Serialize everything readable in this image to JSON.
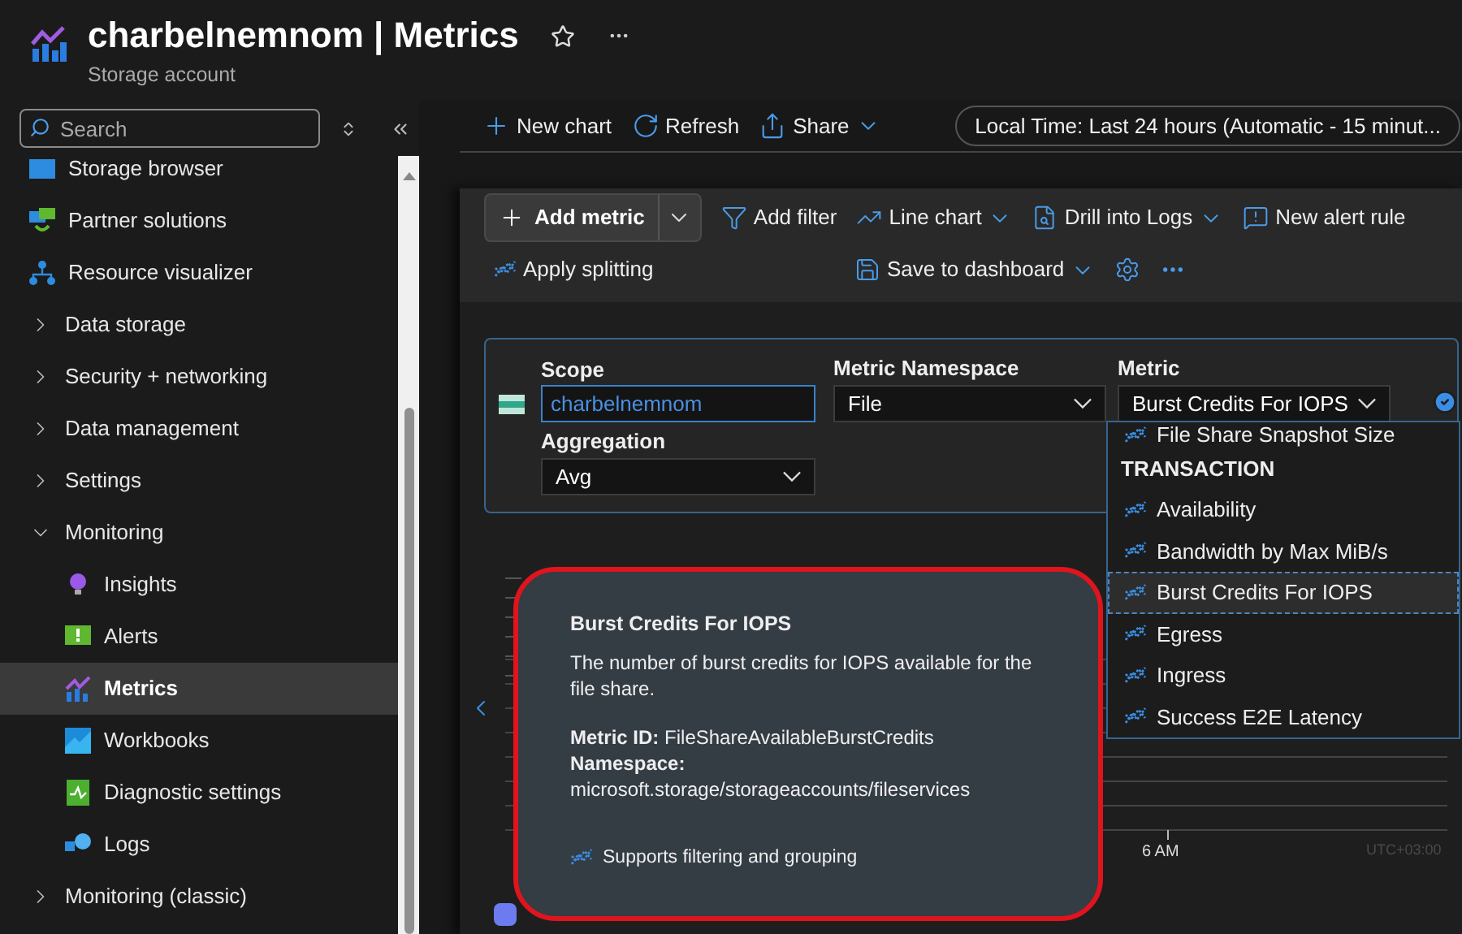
{
  "header": {
    "title": "charbelnemnom | Metrics",
    "subtitle": "Storage account"
  },
  "sidebar": {
    "search": {
      "placeholder": "Search"
    },
    "items": [
      {
        "label": "Storage browser",
        "kind": "link"
      },
      {
        "label": "Partner solutions",
        "kind": "link"
      },
      {
        "label": "Resource visualizer",
        "kind": "link"
      },
      {
        "label": "Data storage",
        "kind": "group",
        "expanded": false
      },
      {
        "label": "Security + networking",
        "kind": "group",
        "expanded": false
      },
      {
        "label": "Data management",
        "kind": "group",
        "expanded": false
      },
      {
        "label": "Settings",
        "kind": "group",
        "expanded": false
      },
      {
        "label": "Monitoring",
        "kind": "group",
        "expanded": true,
        "children": [
          {
            "label": "Insights",
            "selected": false
          },
          {
            "label": "Alerts",
            "selected": false
          },
          {
            "label": "Metrics",
            "selected": true
          },
          {
            "label": "Workbooks",
            "selected": false
          },
          {
            "label": "Diagnostic settings",
            "selected": false
          },
          {
            "label": "Logs",
            "selected": false
          }
        ]
      },
      {
        "label": "Monitoring (classic)",
        "kind": "group",
        "expanded": false
      }
    ]
  },
  "toolbar": {
    "items": [
      "New chart",
      "Refresh",
      "Share"
    ],
    "time_range": "Local Time: Last 24 hours (Automatic - 15 minut..."
  },
  "chart_toolbar": {
    "row_1": [
      {
        "label": "Add metric",
        "kind": "primary"
      },
      {
        "label": "Add filter",
        "kind": "action"
      },
      {
        "label": "Line chart",
        "kind": "dropdown"
      },
      {
        "label": "Drill into Logs",
        "kind": "dropdown"
      },
      {
        "label": "New alert rule",
        "kind": "action"
      }
    ],
    "row_2": [
      {
        "label": "Apply splitting",
        "kind": "action"
      },
      {
        "label": "Save to dashboard",
        "kind": "dropdown"
      }
    ]
  },
  "metric_row": {
    "scope": {
      "label": "Scope",
      "value": "charbelnemnom"
    },
    "namespace": {
      "label": "Metric Namespace",
      "value": "File"
    },
    "metric": {
      "label": "Metric",
      "value": "Burst Credits For IOPS"
    },
    "aggregation": {
      "label": "Aggregation",
      "value": "Avg"
    }
  },
  "metric_list": [
    {
      "kind": "metric",
      "label": "File Share Snapshot Size",
      "selected": false
    },
    {
      "kind": "header",
      "label": "TRANSACTION"
    },
    {
      "kind": "metric",
      "label": "Availability",
      "selected": false
    },
    {
      "kind": "metric",
      "label": "Bandwidth by Max MiB/s",
      "selected": false
    },
    {
      "kind": "metric",
      "label": "Burst Credits For IOPS",
      "selected": true
    },
    {
      "kind": "metric",
      "label": "Egress",
      "selected": false
    },
    {
      "kind": "metric",
      "label": "Ingress",
      "selected": false
    },
    {
      "kind": "metric",
      "label": "Success E2E Latency",
      "selected": false
    }
  ],
  "tooltip": {
    "title": "Burst Credits For IOPS",
    "description": "The number of burst credits for IOPS available for the file share.",
    "metric_id_label": "Metric ID:",
    "metric_id": "FileShareAvailableBurstCredits",
    "namespace_label": "Namespace:",
    "namespace": "microsoft.storage/storageaccounts/fileservices",
    "footer": "Supports filtering and grouping"
  },
  "chart": {
    "x_label": "6 AM",
    "timezone": "UTC+03:00"
  }
}
